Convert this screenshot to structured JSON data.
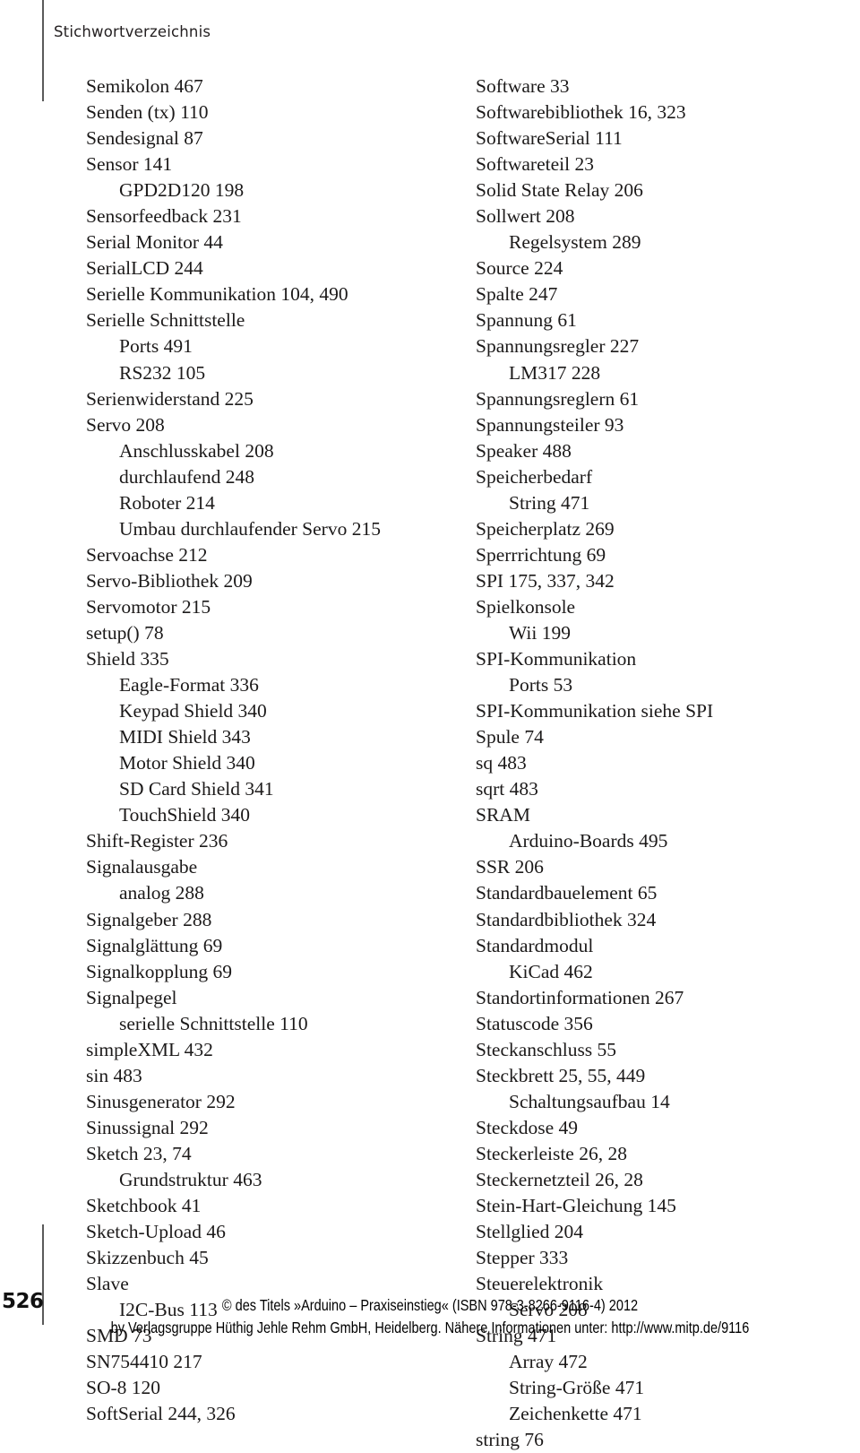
{
  "running_head": "Stichwortverzeichnis",
  "folio": "526",
  "columns": {
    "left": [
      {
        "level": 1,
        "text": "Semikolon 467"
      },
      {
        "level": 1,
        "text": "Senden (tx) 110"
      },
      {
        "level": 1,
        "text": "Sendesignal 87"
      },
      {
        "level": 1,
        "text": "Sensor 141"
      },
      {
        "level": 2,
        "text": "GPD2D120 198"
      },
      {
        "level": 1,
        "text": "Sensorfeedback 231"
      },
      {
        "level": 1,
        "text": "Serial Monitor 44"
      },
      {
        "level": 1,
        "text": "SerialLCD 244"
      },
      {
        "level": 1,
        "text": "Serielle Kommunikation 104, 490"
      },
      {
        "level": 1,
        "text": "Serielle Schnittstelle"
      },
      {
        "level": 2,
        "text": "Ports 491"
      },
      {
        "level": 2,
        "text": "RS232 105"
      },
      {
        "level": 1,
        "text": "Serienwiderstand 225"
      },
      {
        "level": 1,
        "text": "Servo 208"
      },
      {
        "level": 2,
        "text": "Anschlusskabel 208"
      },
      {
        "level": 2,
        "text": "durchlaufend 248"
      },
      {
        "level": 2,
        "text": "Roboter 214"
      },
      {
        "level": 2,
        "text": "Umbau durchlaufender Servo 215"
      },
      {
        "level": 1,
        "text": "Servoachse 212"
      },
      {
        "level": 1,
        "text": "Servo-Bibliothek 209"
      },
      {
        "level": 1,
        "text": "Servomotor 215"
      },
      {
        "level": 1,
        "text": "setup() 78"
      },
      {
        "level": 1,
        "text": "Shield 335"
      },
      {
        "level": 2,
        "text": "Eagle-Format 336"
      },
      {
        "level": 2,
        "text": "Keypad Shield 340"
      },
      {
        "level": 2,
        "text": "MIDI Shield 343"
      },
      {
        "level": 2,
        "text": "Motor Shield 340"
      },
      {
        "level": 2,
        "text": "SD Card Shield 341"
      },
      {
        "level": 2,
        "text": "TouchShield 340"
      },
      {
        "level": 1,
        "text": "Shift-Register 236"
      },
      {
        "level": 1,
        "text": "Signalausgabe"
      },
      {
        "level": 2,
        "text": "analog 288"
      },
      {
        "level": 1,
        "text": "Signalgeber 288"
      },
      {
        "level": 1,
        "text": "Signalglättung 69"
      },
      {
        "level": 1,
        "text": "Signalkopplung 69"
      },
      {
        "level": 1,
        "text": "Signalpegel"
      },
      {
        "level": 2,
        "text": "serielle Schnittstelle 110"
      },
      {
        "level": 1,
        "text": "simpleXML 432"
      },
      {
        "level": 1,
        "text": "sin 483"
      },
      {
        "level": 1,
        "text": "Sinusgenerator 292"
      },
      {
        "level": 1,
        "text": "Sinussignal 292"
      },
      {
        "level": 1,
        "text": "Sketch 23, 74"
      },
      {
        "level": 2,
        "text": "Grundstruktur 463"
      },
      {
        "level": 1,
        "text": "Sketchbook 41"
      },
      {
        "level": 1,
        "text": "Sketch-Upload 46"
      },
      {
        "level": 1,
        "text": "Skizzenbuch 45"
      },
      {
        "level": 1,
        "text": "Slave"
      },
      {
        "level": 2,
        "text": "I2C-Bus 113"
      },
      {
        "level": 1,
        "text": "SMD 73"
      },
      {
        "level": 1,
        "text": "SN754410 217"
      },
      {
        "level": 1,
        "text": "SO-8 120"
      },
      {
        "level": 1,
        "text": "SoftSerial 244, 326"
      }
    ],
    "right": [
      {
        "level": 1,
        "text": "Software 33"
      },
      {
        "level": 1,
        "text": "Softwarebibliothek 16, 323"
      },
      {
        "level": 1,
        "text": "SoftwareSerial 111"
      },
      {
        "level": 1,
        "text": "Softwareteil 23"
      },
      {
        "level": 1,
        "text": "Solid State Relay 206"
      },
      {
        "level": 1,
        "text": "Sollwert 208"
      },
      {
        "level": 2,
        "text": "Regelsystem 289"
      },
      {
        "level": 1,
        "text": "Source 224"
      },
      {
        "level": 1,
        "text": "Spalte 247"
      },
      {
        "level": 1,
        "text": "Spannung 61"
      },
      {
        "level": 1,
        "text": "Spannungsregler 227"
      },
      {
        "level": 2,
        "text": "LM317 228"
      },
      {
        "level": 1,
        "text": "Spannungsreglern 61"
      },
      {
        "level": 1,
        "text": "Spannungsteiler 93"
      },
      {
        "level": 1,
        "text": "Speaker 488"
      },
      {
        "level": 1,
        "text": "Speicherbedarf"
      },
      {
        "level": 2,
        "text": "String 471"
      },
      {
        "level": 1,
        "text": "Speicherplatz 269"
      },
      {
        "level": 1,
        "text": "Sperrrichtung 69"
      },
      {
        "level": 1,
        "text": "SPI 175, 337, 342"
      },
      {
        "level": 1,
        "text": "Spielkonsole"
      },
      {
        "level": 2,
        "text": "Wii 199"
      },
      {
        "level": 1,
        "text": "SPI-Kommunikation"
      },
      {
        "level": 2,
        "text": "Ports 53"
      },
      {
        "level": 1,
        "text": "SPI-Kommunikation siehe SPI"
      },
      {
        "level": 1,
        "text": "Spule 74"
      },
      {
        "level": 1,
        "text": "sq 483"
      },
      {
        "level": 1,
        "text": "sqrt 483"
      },
      {
        "level": 1,
        "text": "SRAM"
      },
      {
        "level": 2,
        "text": "Arduino-Boards 495"
      },
      {
        "level": 1,
        "text": "SSR 206"
      },
      {
        "level": 1,
        "text": "Standardbauelement 65"
      },
      {
        "level": 1,
        "text": "Standardbibliothek 324"
      },
      {
        "level": 1,
        "text": "Standardmodul"
      },
      {
        "level": 2,
        "text": "KiCad 462"
      },
      {
        "level": 1,
        "text": "Standortinformationen 267"
      },
      {
        "level": 1,
        "text": "Statuscode 356"
      },
      {
        "level": 1,
        "text": "Steckanschluss 55"
      },
      {
        "level": 1,
        "text": "Steckbrett 25, 55, 449"
      },
      {
        "level": 2,
        "text": "Schaltungsaufbau 14"
      },
      {
        "level": 1,
        "text": "Steckdose 49"
      },
      {
        "level": 1,
        "text": "Steckerleiste 26, 28"
      },
      {
        "level": 1,
        "text": "Steckernetzteil 26, 28"
      },
      {
        "level": 1,
        "text": "Stein-Hart-Gleichung 145"
      },
      {
        "level": 1,
        "text": "Stellglied 204"
      },
      {
        "level": 1,
        "text": "Stepper 333"
      },
      {
        "level": 1,
        "text": "Steuerelektronik"
      },
      {
        "level": 2,
        "text": "Servo 208"
      },
      {
        "level": 1,
        "text": "String 471"
      },
      {
        "level": 2,
        "text": "Array 472"
      },
      {
        "level": 2,
        "text": "String-Größe 471"
      },
      {
        "level": 2,
        "text": "Zeichenkette 471"
      },
      {
        "level": 1,
        "text": "string 76"
      }
    ]
  },
  "footer": {
    "line1": "© des Titels »Arduino – Praxiseinstieg« (ISBN 978-3-8266-9116-4) 2012",
    "line2": "by Verlagsgruppe Hüthig Jehle Rehm GmbH, Heidelberg. Nähere Informationen unter: http://www.mitp.de/9116"
  }
}
